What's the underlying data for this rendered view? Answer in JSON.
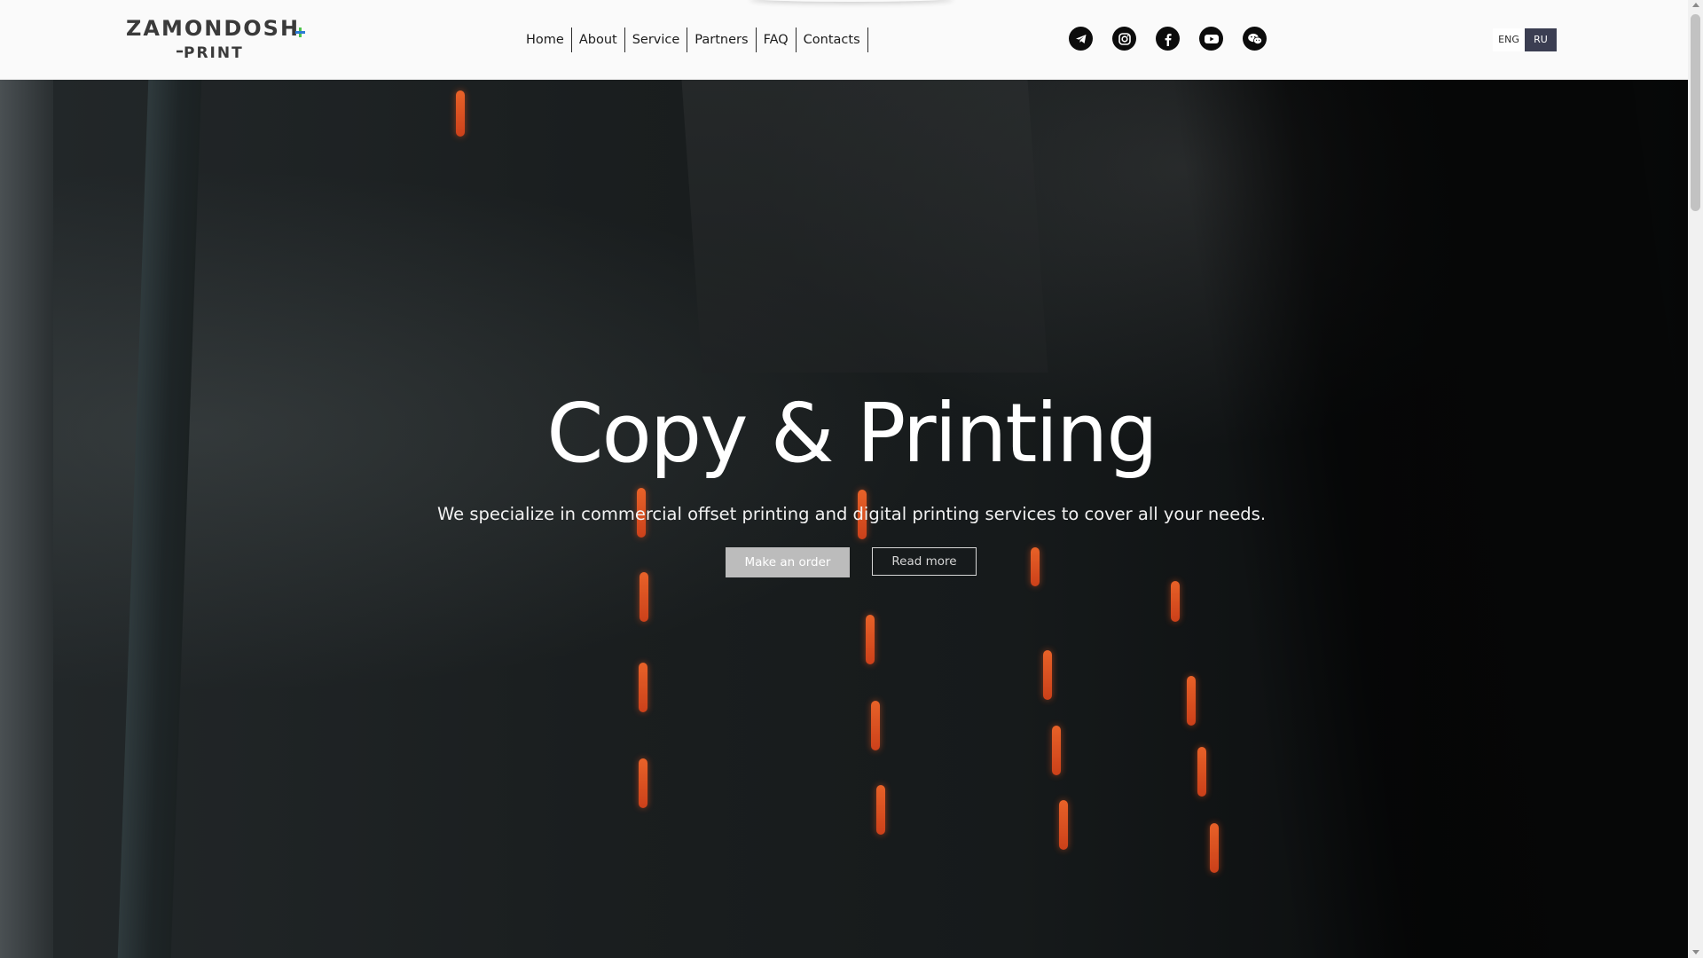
{
  "header": {
    "logo": {
      "line1": "ZAMONDOSH",
      "line2": "PRINT",
      "accent_colors": [
        "#2b7bd4",
        "#4cc44a"
      ]
    },
    "nav": [
      {
        "label": "Home"
      },
      {
        "label": "About"
      },
      {
        "label": "Service"
      },
      {
        "label": "Partners"
      },
      {
        "label": "FAQ"
      },
      {
        "label": "Contacts"
      }
    ],
    "social": [
      {
        "name": "telegram-icon"
      },
      {
        "name": "instagram-icon"
      },
      {
        "name": "facebook-icon"
      },
      {
        "name": "youtube-icon"
      },
      {
        "name": "wechat-icon"
      }
    ],
    "languages": {
      "eng": "ENG",
      "ru": "RU",
      "active": "RU"
    }
  },
  "hero": {
    "title": "Copy & Printing",
    "subtitle": "We specialize in commercial offset printing and digital printing services to cover all your needs.",
    "primary_button": "Make an order",
    "secondary_button": "Read more"
  },
  "colors": {
    "header_bg": "#fafafa",
    "active_lang_bg": "#3b3e52",
    "primary_button_bg": "#bcbcbc",
    "led_orange": "#ff6a2a"
  }
}
